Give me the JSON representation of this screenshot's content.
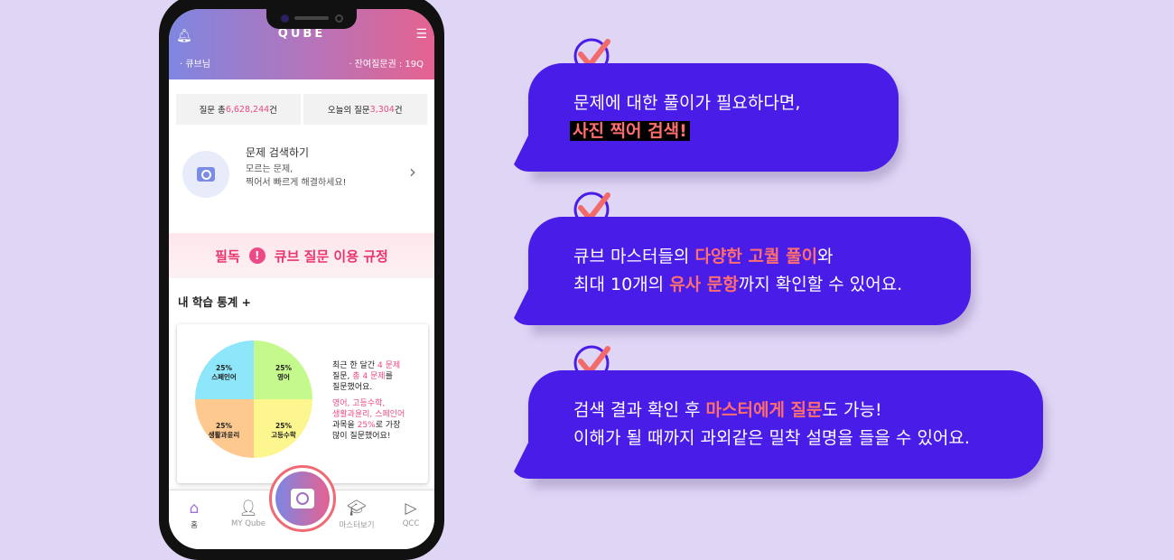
{
  "phone": {
    "app_title": "QUBE",
    "user": "· 큐브님",
    "remaining": "· 잔여질문권 : 19Q",
    "stats": [
      {
        "label": "질문 총 ",
        "value": "6,628,244",
        "unit": "건"
      },
      {
        "label": "오늘의 질문 ",
        "value": "3,304",
        "unit": "건"
      }
    ],
    "search": {
      "title": "문제 검색하기",
      "desc1": "모르는 문제,",
      "desc2": "찍어서 빠르게 해결하세요!"
    },
    "banner": {
      "left": "필독",
      "right": "큐브 질문 이용 규정"
    },
    "my_stats": "내 학습 통계  +",
    "summary": {
      "l1a": "최근 한 달간 ",
      "l1b": "4 문제",
      "l2a": "질문, ",
      "l2b": "총 4 문제",
      "l2c": "를",
      "l3": "질문했어요.",
      "l4": "영어, 고등수학,",
      "l5": "생활과윤리, 스페인어",
      "l6a": "과목을 ",
      "l6b": "25%",
      "l6c": "로 가장",
      "l7": "많이 질문했어요!"
    },
    "nav": [
      {
        "label": "홈",
        "icon": "home-icon"
      },
      {
        "label": "MY Qube",
        "icon": "user-icon"
      },
      {
        "label": "마스터보기",
        "icon": "graduation-cap-icon"
      },
      {
        "label": "QCC",
        "icon": "video-edit-icon"
      }
    ]
  },
  "chart_data": {
    "type": "pie",
    "slices": [
      {
        "label": "스페인어",
        "value": 25,
        "display": "25%",
        "color": "#8ee6fb"
      },
      {
        "label": "영어",
        "value": 25,
        "display": "25%",
        "color": "#c4f98e"
      },
      {
        "label": "고등수학",
        "value": 25,
        "display": "25%",
        "color": "#fdf58e"
      },
      {
        "label": "생활과윤리",
        "value": 25,
        "display": "25%",
        "color": "#fdc98e"
      }
    ]
  },
  "bubbles": [
    {
      "l1": "문제에 대한 풀이가 필요하다면,",
      "l2": "사진 찍어 검색!"
    },
    {
      "l1a": "큐브 마스터들의 ",
      "l1b": "다양한 고퀄 풀이",
      "l1c": "와",
      "l2a": "최대 10개의 ",
      "l2b": "유사 문항",
      "l2c": "까지 확인할 수 있어요."
    },
    {
      "l1a": "검색 결과 확인 후 ",
      "l1b": "마스터에게 질문",
      "l1c": "도 가능!",
      "l2": "이해가 될 때까지 과외같은 밀착 설명을 들을 수 있어요."
    }
  ],
  "colors": {
    "bubble": "#4a1ce8",
    "highlight": "#ff6e6e",
    "pink": "#ec4a86",
    "background": "#dfd5f5"
  }
}
